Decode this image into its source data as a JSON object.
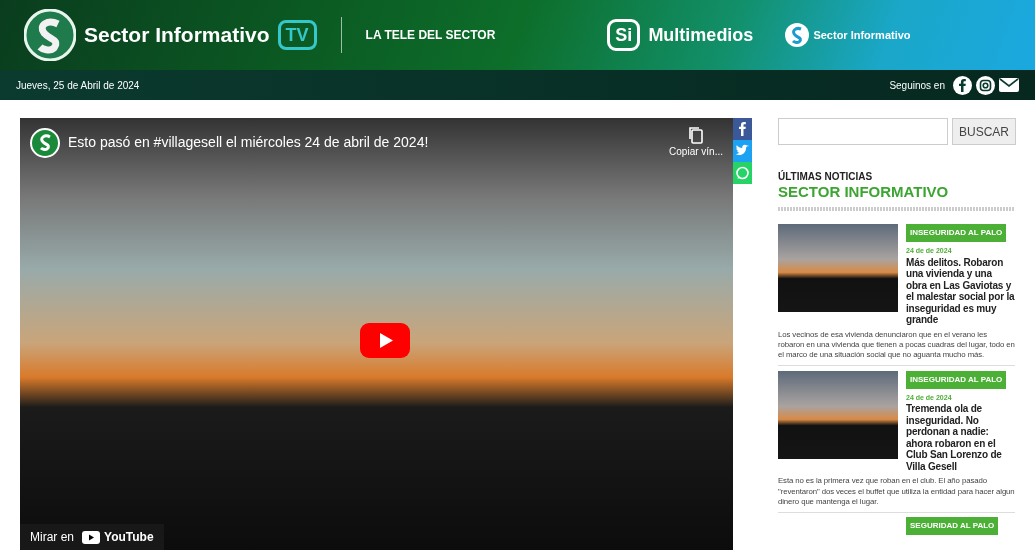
{
  "header": {
    "logo_text": "Sector Informativo",
    "logo_badge": "TV",
    "tagline": "LA TELE DEL SECTOR",
    "si_mark": "Si",
    "multimedios": "Multimedios",
    "brand_small": "Sector Informativo"
  },
  "subbar": {
    "date": "Jueves, 25 de Abril de 2024",
    "follow": "Seguinos en"
  },
  "video": {
    "title": "Esto pasó en #villagesell el miércoles 24 de abril de 2024!",
    "copy_link": "Copiar vín...",
    "watch_on": "Mirar en",
    "youtube": "YouTube"
  },
  "share": [
    {
      "kind": "facebook",
      "color": "#3b5998"
    },
    {
      "kind": "twitter",
      "color": "#1da1f2"
    },
    {
      "kind": "whatsapp",
      "color": "#25d366"
    }
  ],
  "sidebar": {
    "search_button": "BUSCAR",
    "heading_small": "ÚLTIMAS NOTICIAS",
    "heading_big": "SECTOR INFORMATIVO",
    "news": [
      {
        "category": "INSEGURIDAD AL PALO",
        "date": "24 de de 2024",
        "title": "Más delitos. Robaron una vivienda y una obra en Las Gaviotas y el malestar social por la inseguridad es muy grande",
        "summary": "Los vecinos de esa vivienda denunciaron que en el verano les robaron en una vivienda que tienen a pocas cuadras del lugar, todo en el marco de una situación social que no aguanta mucho más."
      },
      {
        "category": "INSEGURIDAD AL PALO",
        "date": "24 de de 2024",
        "title": "Tremenda ola de inseguridad. No perdonan a nadie: ahora robaron en el Club San Lorenzo de Villa Gesell",
        "summary": "Esta no es la primera vez que roban en el club. El año pasado \"reventaron\" dos veces el buffet que utiliza la entidad para hacer algun dinero que mantenga el lugar."
      },
      {
        "category": "SEGURIDAD AL PALO"
      }
    ]
  }
}
